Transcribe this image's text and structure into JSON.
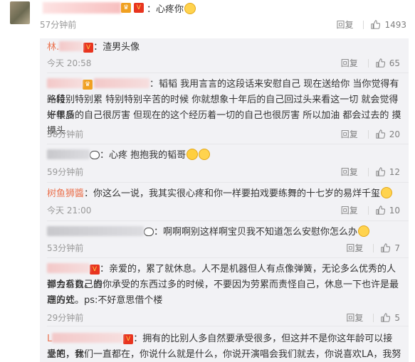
{
  "top_comment": {
    "separator": "：",
    "text": "心疼你",
    "time": "57分钟前",
    "reply_label": "回复",
    "like_count": "1493"
  },
  "replies": [
    {
      "name": "林.",
      "text": "：渣男头像",
      "time": "今天 20:58",
      "reply_label": "回复",
      "like_count": "65"
    },
    {
      "text_lines": [
        "：韬韬 我用言言的这段话来安慰自己 现在送给你 当你觉得有一段",
        "路特别特别累 特别特别辛苦的时候 你就想象十年后的自己回过头来看这一切 就会觉得好很多",
        "十年后的自己很厉害 但现在的这个经历着一切的自己也很厉害   所以加油 都会过去的 摸摸头"
      ],
      "time": "58分钟前",
      "reply_label": "回复",
      "like_count": "20"
    },
    {
      "text": "：心疼 抱抱我的韬哥",
      "time": "59分钟前",
      "reply_label": "回复",
      "like_count": "12"
    },
    {
      "name": "树鱼狮醬",
      "text": "：你这么一说，我其实很心疼和你一样要拍戏要练舞的十七岁的易烊千玺",
      "time": "今天 21:00",
      "reply_label": "回复",
      "like_count": "10"
    },
    {
      "text": "：啊啊啊别这样啊宝贝我不知道怎么安慰你怎么办",
      "time": "53分钟前",
      "reply_label": "回复",
      "like_count": "7"
    },
    {
      "text_lines": [
        "：亲爱的，累了就休息。人不是机器但人有点像弹簧，无论多么优秀的人都会有自己的",
        "弹力系数。当你承受的东西过多的时候，不要因为劳累而责怪自己，休息一下也许是最高的处",
        "理方式。ps:不好意思借个楼"
      ],
      "time": "29分钟前",
      "reply_label": "回复",
      "like_count": "5"
    },
    {
      "name": "L",
      "text_lines": [
        "：拥有的比别人多自然要承受很多，但这并不是你这年龄可以接受的，休",
        "息吧，我们一直都在，你说什么就是什么，你说开演唱会我们就去，你说喜欢LA，我努力学英"
      ]
    }
  ],
  "icons": {
    "like": "thumb-up-icon",
    "vip": "vip-badge-icon",
    "emoji": "emoji-icon",
    "panda": "panda-emoji-icon"
  },
  "colors": {
    "username": "#eb7350",
    "meta": "#999999",
    "panel": "#f2f2f5"
  }
}
